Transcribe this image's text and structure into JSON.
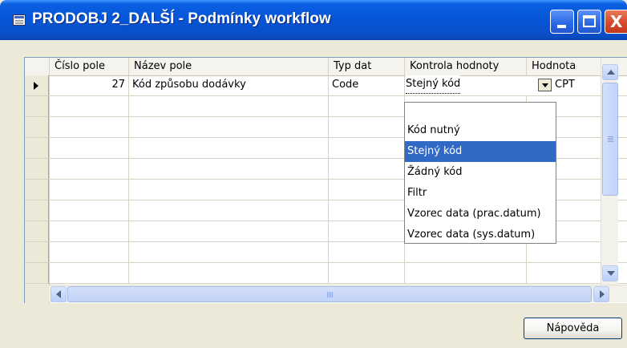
{
  "window": {
    "title": "PRODOBJ 2_DALŠÍ - Podmínky workflow",
    "title_icon": "table-window-icon",
    "controls": [
      "minimize-icon",
      "maximize-icon",
      "close-icon"
    ],
    "close_glyph": "X"
  },
  "grid": {
    "columns": [
      {
        "key": "field_no",
        "label": "Číslo pole"
      },
      {
        "key": "field_name",
        "label": "Název pole"
      },
      {
        "key": "data_type",
        "label": "Typ dat"
      },
      {
        "key": "value_check",
        "label": "Kontrola hodnoty"
      },
      {
        "key": "value",
        "label": "Hodnota"
      }
    ],
    "rows": [
      {
        "field_no": "27",
        "field_name": "Kód způsobu dodávky",
        "data_type": "Code",
        "value_check": "Stejný kód",
        "value": "CPT",
        "current": true
      },
      {
        "field_no": "",
        "field_name": "",
        "data_type": "",
        "value_check": "",
        "value": ""
      },
      {
        "field_no": "",
        "field_name": "",
        "data_type": "",
        "value_check": "",
        "value": ""
      },
      {
        "field_no": "",
        "field_name": "",
        "data_type": "",
        "value_check": "",
        "value": ""
      },
      {
        "field_no": "",
        "field_name": "",
        "data_type": "",
        "value_check": "",
        "value": ""
      },
      {
        "field_no": "",
        "field_name": "",
        "data_type": "",
        "value_check": "",
        "value": ""
      },
      {
        "field_no": "",
        "field_name": "",
        "data_type": "",
        "value_check": "",
        "value": ""
      },
      {
        "field_no": "",
        "field_name": "",
        "data_type": "",
        "value_check": "",
        "value": ""
      },
      {
        "field_no": "",
        "field_name": "",
        "data_type": "",
        "value_check": "",
        "value": ""
      },
      {
        "field_no": "",
        "field_name": "",
        "data_type": "",
        "value_check": "",
        "value": ""
      }
    ],
    "dropdown": {
      "options": [
        "Kód nutný",
        "Stejný kód",
        "Žádný kód",
        "Filtr",
        "Vzorec data (prac.datum)",
        "Vzorec data (sys.datum)"
      ],
      "selected": "Stejný kód"
    },
    "hscroll_grip": "III"
  },
  "buttons": {
    "help": "Nápověda"
  },
  "colors": {
    "titlebar": "#0556d8",
    "selection": "#316ac5",
    "face": "#ece9d8"
  }
}
